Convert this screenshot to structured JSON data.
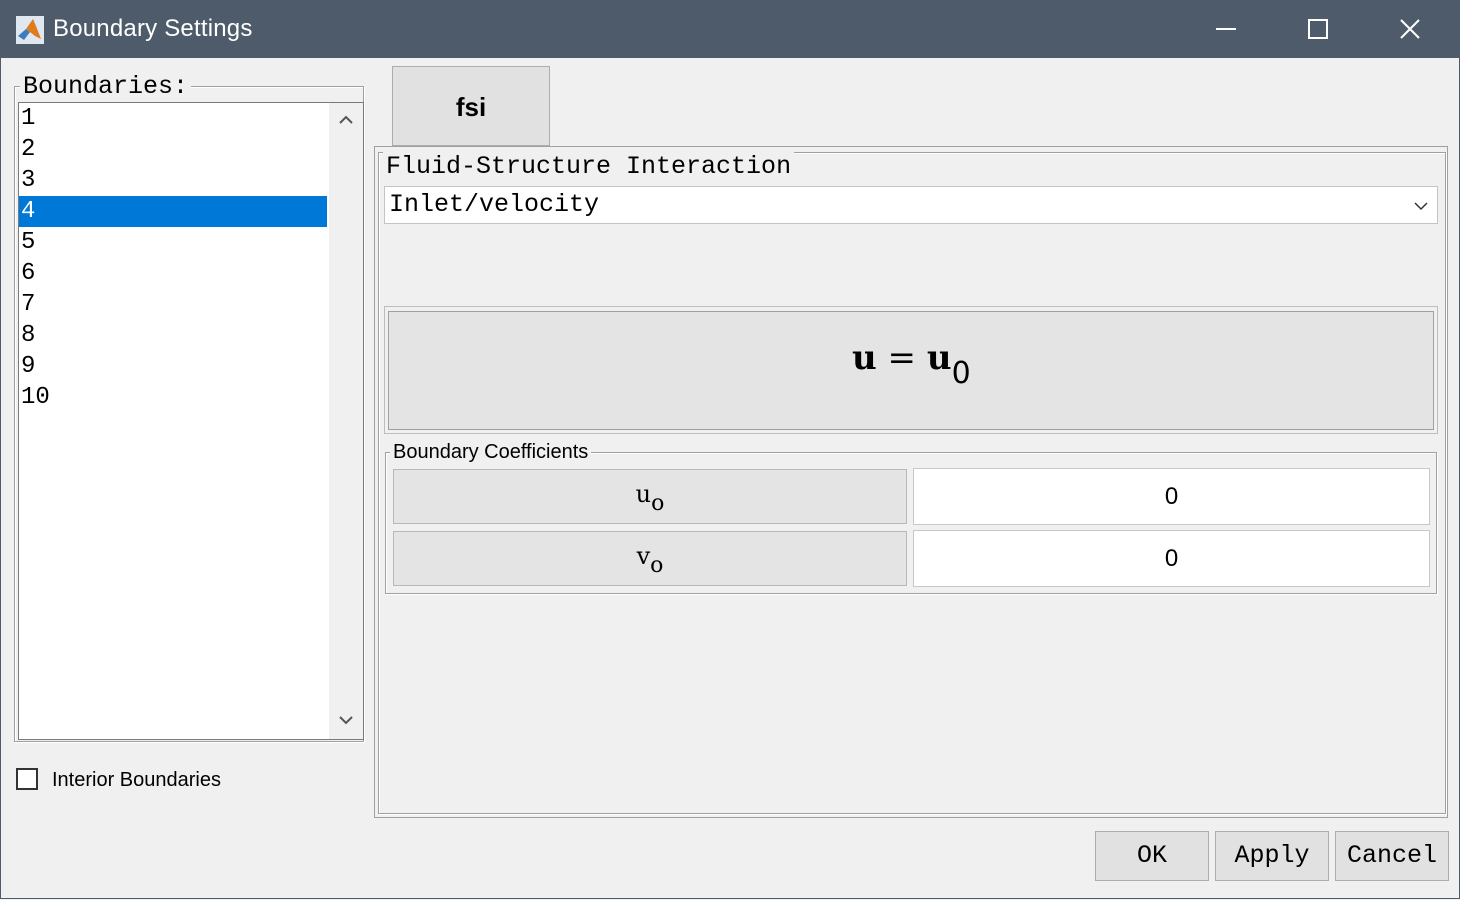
{
  "window": {
    "title": "Boundary Settings",
    "icon": "matlab-icon",
    "controls": [
      "minimize-icon",
      "maximize-icon",
      "close-icon"
    ]
  },
  "boundaries": {
    "legend": "Boundaries:",
    "items": [
      "1",
      "2",
      "3",
      "4",
      "5",
      "6",
      "7",
      "8",
      "9",
      "10"
    ],
    "selected": "4"
  },
  "interior": {
    "label": "Interior Boundaries",
    "checked": false
  },
  "tab": {
    "label": "fsi"
  },
  "physics": {
    "legend": "Fluid-Structure Interaction",
    "selected_type": "Inlet/velocity"
  },
  "equation": {
    "lhs": "u",
    "eq": " = ",
    "rhs": "u",
    "rhs_sub": "0"
  },
  "coefficients": {
    "legend": "Boundary Coefficients",
    "rows": [
      {
        "name": "u",
        "sub": "o",
        "value": "0"
      },
      {
        "name": "v",
        "sub": "o",
        "value": "0"
      }
    ]
  },
  "buttons": {
    "ok": "OK",
    "apply": "Apply",
    "cancel": "Cancel"
  },
  "colors": {
    "titlebar": "#4d5b6a",
    "selection": "#0078d7",
    "background": "#f0f0f0"
  }
}
